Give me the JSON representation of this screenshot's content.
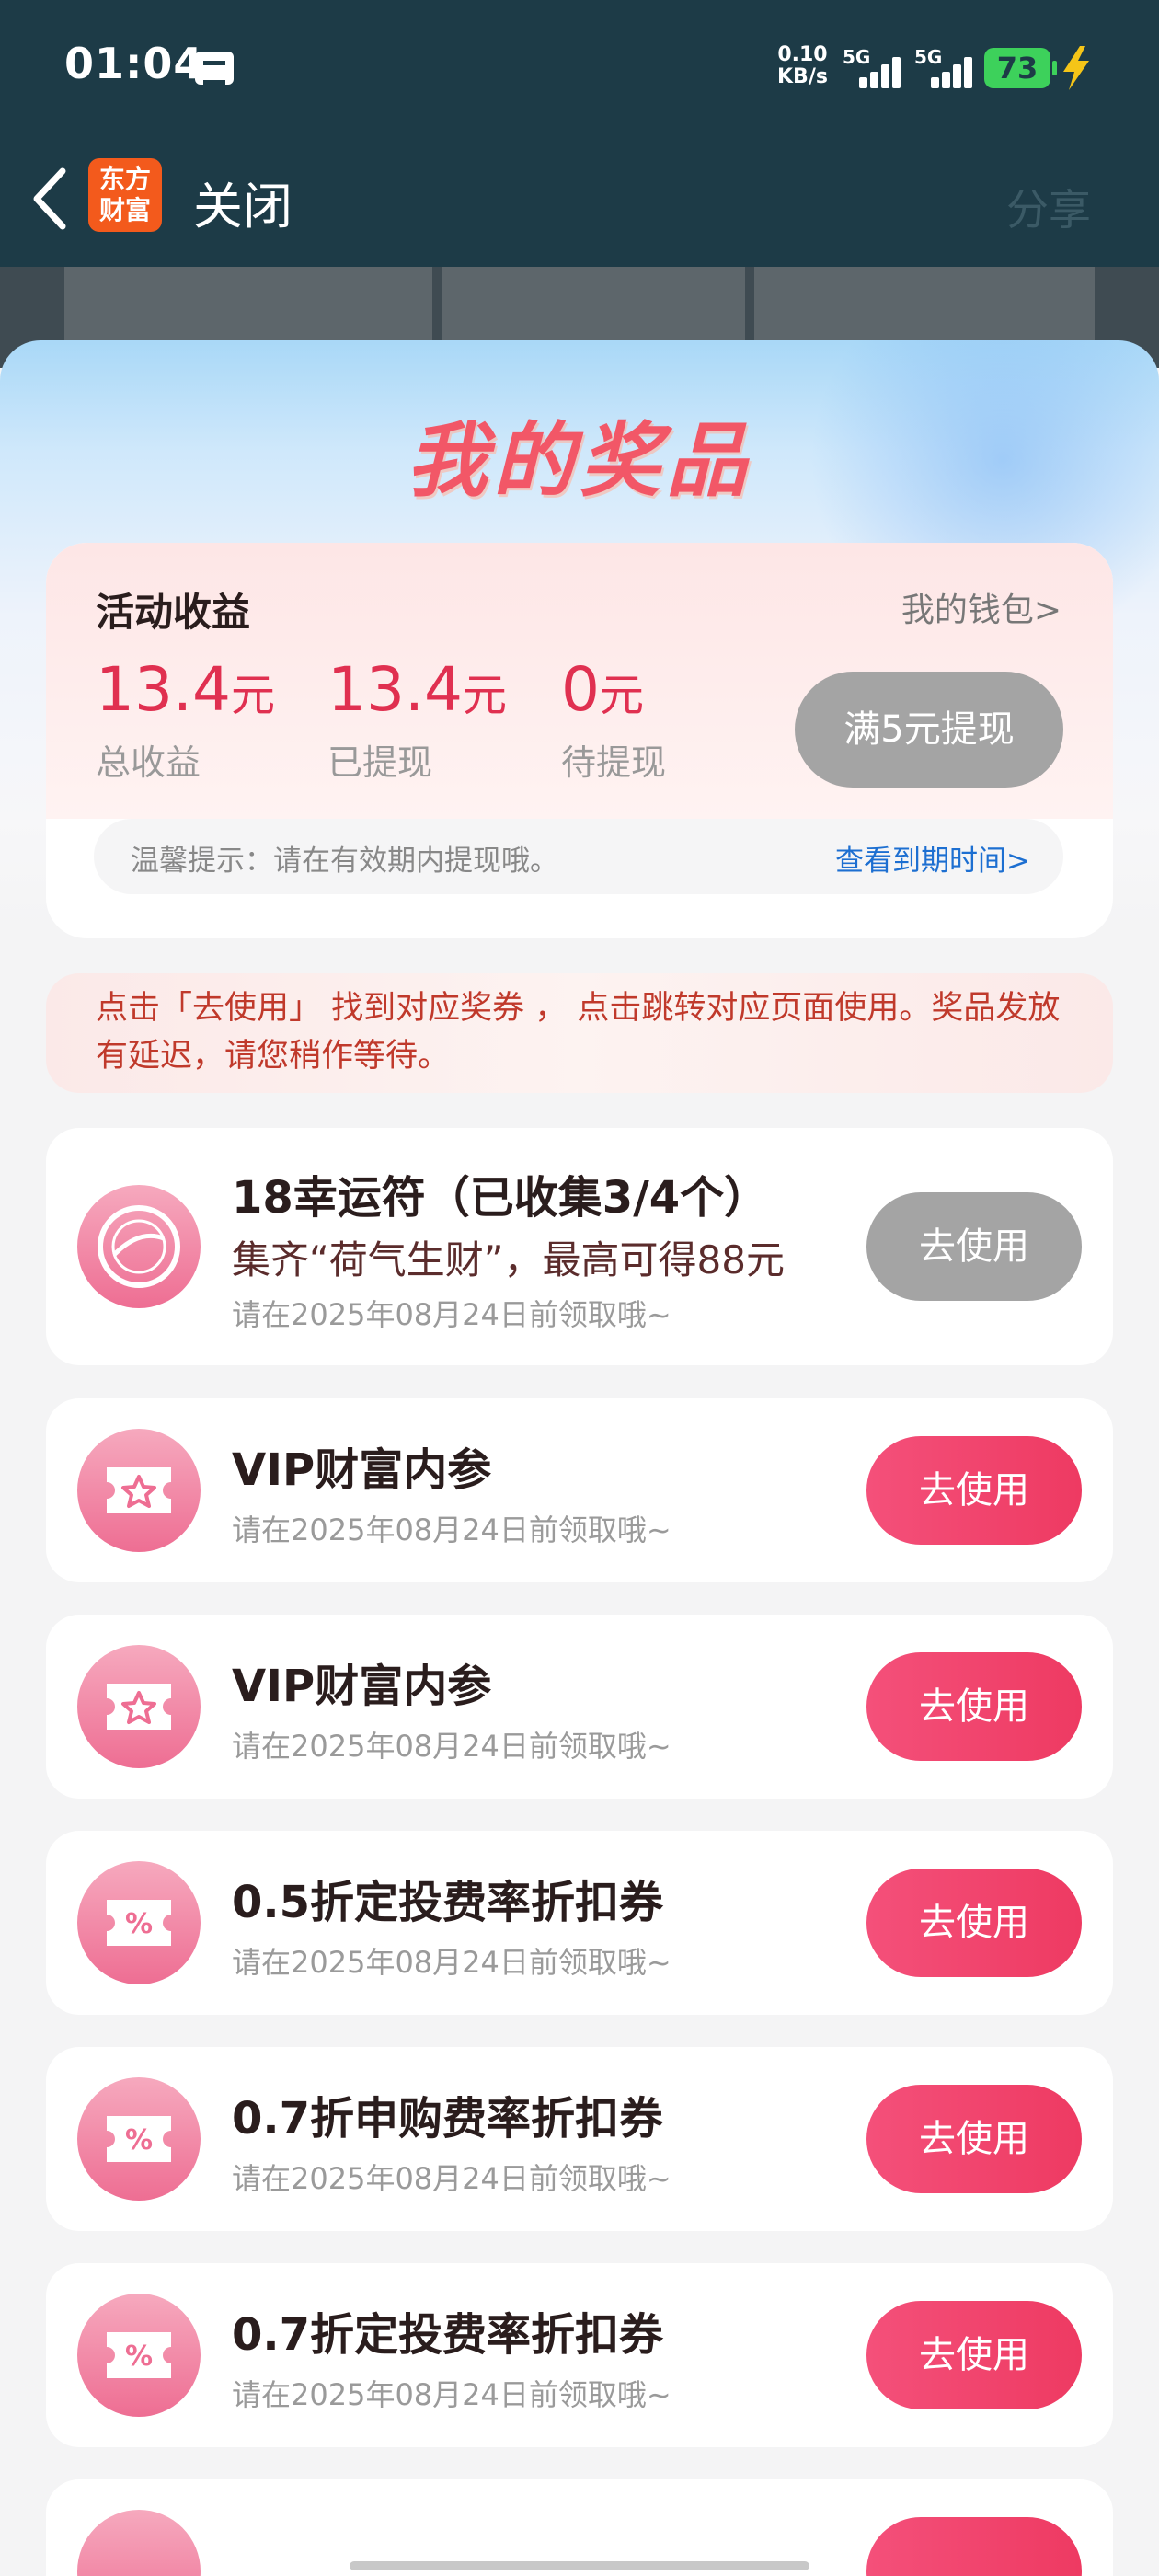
{
  "status_bar": {
    "time": "01:04",
    "net_speed_value": "0.10",
    "net_speed_unit": "KB/s",
    "signal1_label": "5G",
    "signal2_label": "5G",
    "battery": "73"
  },
  "nav": {
    "logo_line1": "东方",
    "logo_line2": "财富",
    "close_label": "关闭",
    "share_label": "分享"
  },
  "page": {
    "title": "我的奖品"
  },
  "earnings": {
    "title": "活动收益",
    "wallet_link": "我的钱包>",
    "stats": [
      {
        "value": "13.4",
        "unit": "元",
        "label": "总收益"
      },
      {
        "value": "13.4",
        "unit": "元",
        "label": "已提现"
      },
      {
        "value": "0",
        "unit": "元",
        "label": "待提现"
      }
    ],
    "withdraw_button": "满5元提现",
    "tip_text": "温馨提示：请在有效期内提现哦。",
    "tip_link": "查看到期时间>"
  },
  "notice": "点击「去使用」 找到对应奖券 ， 点击跳转对应页面使用。奖品发放有延迟，请您稍作等待。",
  "prizes": [
    {
      "title": "18幸运符（已收集3/4个）",
      "subtitle": "集齐“荷气生财”，最高可得88元",
      "date": "请在2025年08月24日前领取哦~",
      "button": "去使用",
      "icon": "lucky-charm-icon",
      "enabled": false
    },
    {
      "title": "VIP财富内参",
      "subtitle": "",
      "date": "请在2025年08月24日前领取哦~",
      "button": "去使用",
      "icon": "star-ticket-icon",
      "enabled": true
    },
    {
      "title": "VIP财富内参",
      "subtitle": "",
      "date": "请在2025年08月24日前领取哦~",
      "button": "去使用",
      "icon": "star-ticket-icon",
      "enabled": true
    },
    {
      "title": "0.5折定投费率折扣券",
      "subtitle": "",
      "date": "请在2025年08月24日前领取哦~",
      "button": "去使用",
      "icon": "percent-ticket-icon",
      "enabled": true
    },
    {
      "title": "0.7折申购费率折扣券",
      "subtitle": "",
      "date": "请在2025年08月24日前领取哦~",
      "button": "去使用",
      "icon": "percent-ticket-icon",
      "enabled": true
    },
    {
      "title": "0.7折定投费率折扣券",
      "subtitle": "",
      "date": "请在2025年08月24日前领取哦~",
      "button": "去使用",
      "icon": "percent-ticket-icon",
      "enabled": true
    }
  ],
  "colors": {
    "header_bg": "#1d3b47",
    "accent_red": "#e03050",
    "button_pink": "#ee3a62",
    "button_disabled": "#a4a4a4"
  }
}
